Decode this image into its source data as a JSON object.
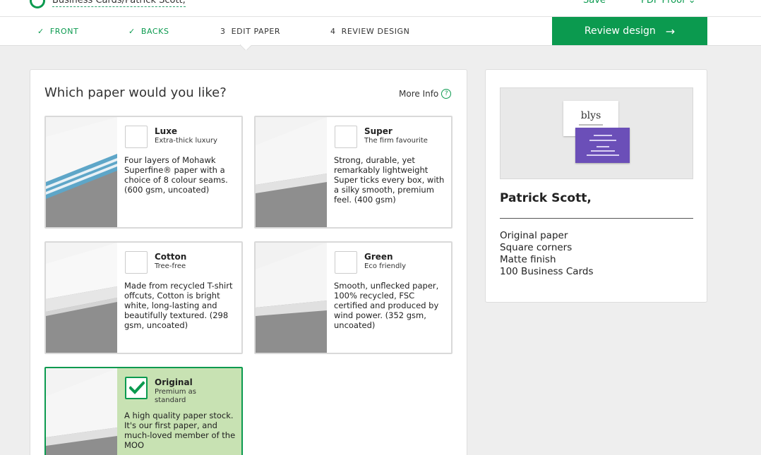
{
  "header": {
    "doc_title": "Business Cards/Patrick Scott,",
    "save_label": "Save",
    "proof_label": "PDF Proof"
  },
  "steps": [
    {
      "mark": "✓",
      "label": "FRONT"
    },
    {
      "mark": "✓",
      "label": "BACKS"
    },
    {
      "mark": "3",
      "label": "EDIT PAPER"
    },
    {
      "mark": "4",
      "label": "REVIEW DESIGN"
    }
  ],
  "review_button": {
    "label": "Review design",
    "arrow": "→"
  },
  "main": {
    "title": "Which paper would you like?",
    "more_info": "More Info",
    "help_glyph": "?"
  },
  "papers": [
    {
      "name": "Luxe",
      "tagline": "Extra-thick luxury",
      "description": "Four layers of Mohawk Superfine® paper with a choice of 8 colour seams. (600 gsm, uncoated)",
      "selected": false
    },
    {
      "name": "Super",
      "tagline": "The firm favourite",
      "description": "Strong, durable, yet remarkably lightweight Super ticks every box, with a silky smooth, premium feel. (400 gsm)",
      "selected": false
    },
    {
      "name": "Cotton",
      "tagline": "Tree-free",
      "description": "Made from recycled T-shirt offcuts, Cotton is bright white, long-lasting and beautifully textured. (298 gsm, uncoated)",
      "selected": false
    },
    {
      "name": "Green",
      "tagline": "Eco friendly",
      "description": "Smooth, unflecked paper, 100% recycled, FSC certified and produced by wind power. (352 gsm, uncoated)",
      "selected": false
    },
    {
      "name": "Original",
      "tagline": "Premium as standard",
      "description": "A high quality paper stock. It's our first paper, and much-loved member of the MOO",
      "selected": true
    }
  ],
  "summary": {
    "card_logo": "blys",
    "name": "Patrick Scott,",
    "specs": [
      "Original paper",
      "Square corners",
      "Matte finish",
      "100 Business Cards"
    ]
  },
  "colors": {
    "accent": "#0b9a4f",
    "selected_bg": "#c8e2b3",
    "card_back": "#6b4fb8"
  }
}
